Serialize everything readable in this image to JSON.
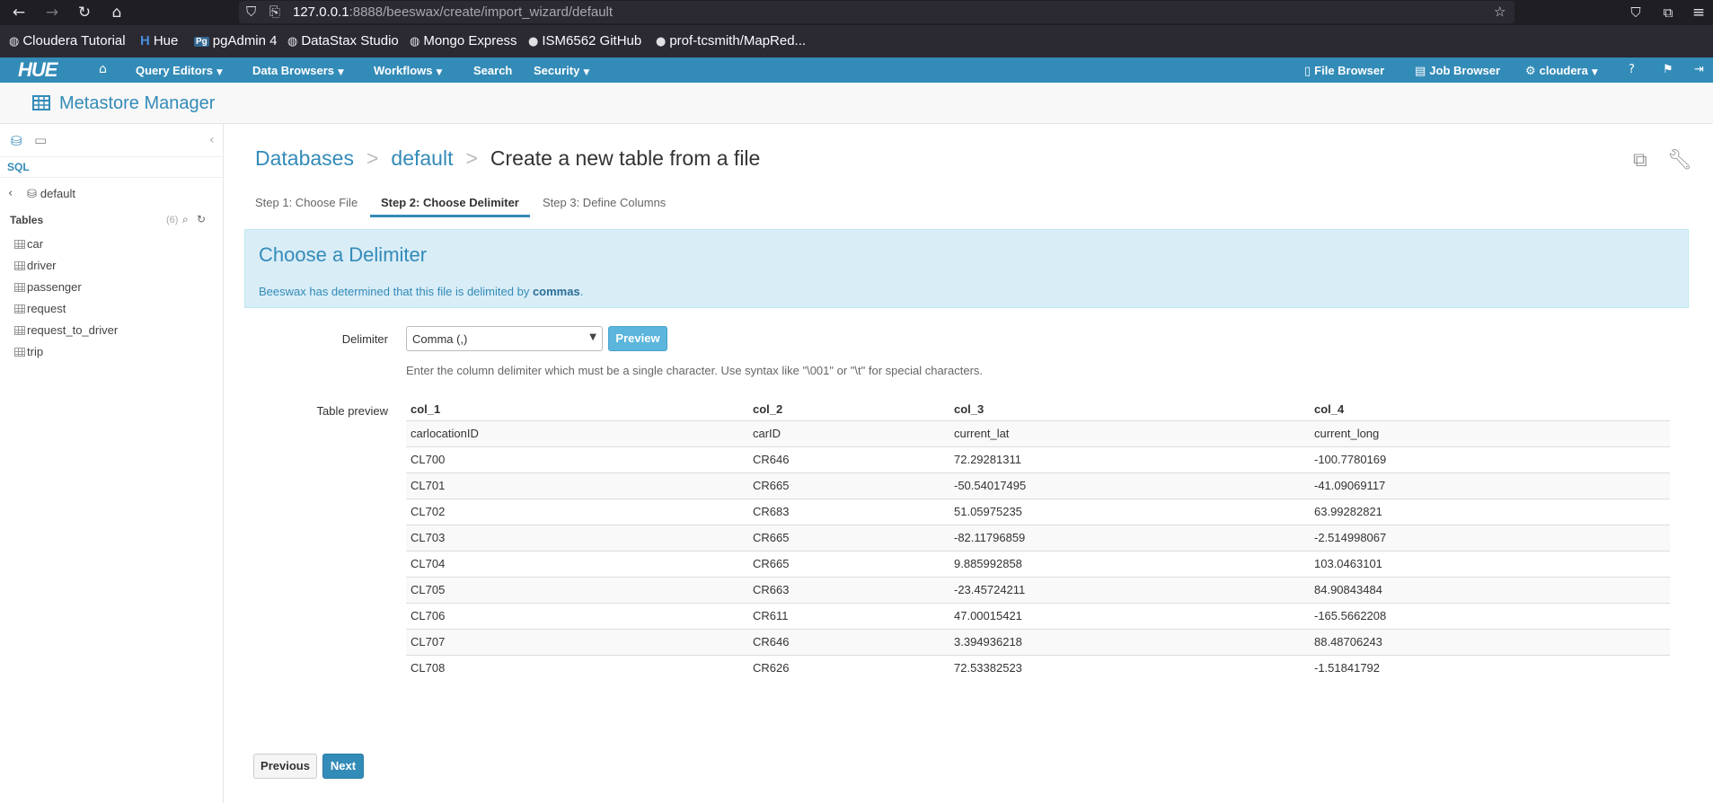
{
  "browser": {
    "url_host": "127.0.0.1",
    "url_rest": ":8888/beeswax/create/import_wizard/default",
    "bookmarks": [
      {
        "label": "Cloudera Tutorial",
        "icon": "globe-icon"
      },
      {
        "label": "Hue",
        "icon": "hue-icon"
      },
      {
        "label": "pgAdmin 4",
        "icon": "pgadmin-icon"
      },
      {
        "label": "DataStax Studio",
        "icon": "globe-icon"
      },
      {
        "label": "Mongo Express",
        "icon": "globe-icon"
      },
      {
        "label": "ISM6562 GitHub",
        "icon": "github-icon"
      },
      {
        "label": "prof-tcsmith/MapRed...",
        "icon": "github-icon"
      }
    ]
  },
  "hue_nav": {
    "logo": "HUE",
    "query_editors": "Query Editors",
    "data_browsers": "Data Browsers",
    "workflows": "Workflows",
    "search": "Search",
    "security": "Security",
    "file_browser": "File Browser",
    "job_browser": "Job Browser",
    "user": "cloudera"
  },
  "app": {
    "title": "Metastore Manager"
  },
  "sidebar": {
    "sql_label": "SQL",
    "database": "default",
    "tables_label": "Tables",
    "tables_count": "(6)",
    "tables": [
      "car",
      "driver",
      "passenger",
      "request",
      "request_to_driver",
      "trip"
    ]
  },
  "breadcrumb": {
    "databases": "Databases",
    "database": "default",
    "current": "Create a new table from a file"
  },
  "steps": {
    "step1": "Step 1: Choose File",
    "step2": "Step 2: Choose Delimiter",
    "step3": "Step 3: Define Columns"
  },
  "alert": {
    "title": "Choose a Delimiter",
    "text_prefix": "Beeswax has determined that this file is delimited by ",
    "delimiter_word": "commas",
    "text_suffix": "."
  },
  "form": {
    "delimiter_label": "Delimiter",
    "delimiter_value": "Comma (,)",
    "preview_button": "Preview",
    "help_text": "Enter the column delimiter which must be a single character. Use syntax like \"\\001\" or \"\\t\" for special characters.",
    "table_preview_label": "Table preview"
  },
  "preview": {
    "headers": [
      "col_1",
      "col_2",
      "col_3",
      "col_4"
    ],
    "rows": [
      [
        "carlocationID",
        "carID",
        "current_lat",
        "current_long"
      ],
      [
        "CL700",
        "CR646",
        "72.29281311",
        "-100.7780169"
      ],
      [
        "CL701",
        "CR665",
        "-50.54017495",
        "-41.09069117"
      ],
      [
        "CL702",
        "CR683",
        "51.05975235",
        "63.99282821"
      ],
      [
        "CL703",
        "CR665",
        "-82.11796859",
        "-2.514998067"
      ],
      [
        "CL704",
        "CR665",
        "9.885992858",
        "103.0463101"
      ],
      [
        "CL705",
        "CR663",
        "-23.45724211",
        "84.90843484"
      ],
      [
        "CL706",
        "CR611",
        "47.00015421",
        "-165.5662208"
      ],
      [
        "CL707",
        "CR646",
        "3.394936218",
        "88.48706243"
      ],
      [
        "CL708",
        "CR626",
        "72.53382523",
        "-1.51841792"
      ]
    ]
  },
  "buttons": {
    "previous": "Previous",
    "next": "Next"
  }
}
